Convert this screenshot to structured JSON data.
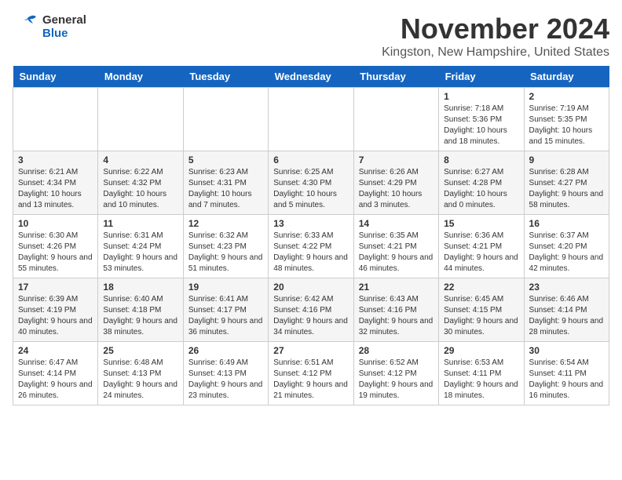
{
  "header": {
    "logo_general": "General",
    "logo_blue": "Blue",
    "month_title": "November 2024",
    "location": "Kingston, New Hampshire, United States"
  },
  "weekdays": [
    "Sunday",
    "Monday",
    "Tuesday",
    "Wednesday",
    "Thursday",
    "Friday",
    "Saturday"
  ],
  "weeks": [
    [
      {
        "day": "",
        "info": ""
      },
      {
        "day": "",
        "info": ""
      },
      {
        "day": "",
        "info": ""
      },
      {
        "day": "",
        "info": ""
      },
      {
        "day": "",
        "info": ""
      },
      {
        "day": "1",
        "info": "Sunrise: 7:18 AM\nSunset: 5:36 PM\nDaylight: 10 hours and 18 minutes."
      },
      {
        "day": "2",
        "info": "Sunrise: 7:19 AM\nSunset: 5:35 PM\nDaylight: 10 hours and 15 minutes."
      }
    ],
    [
      {
        "day": "3",
        "info": "Sunrise: 6:21 AM\nSunset: 4:34 PM\nDaylight: 10 hours and 13 minutes."
      },
      {
        "day": "4",
        "info": "Sunrise: 6:22 AM\nSunset: 4:32 PM\nDaylight: 10 hours and 10 minutes."
      },
      {
        "day": "5",
        "info": "Sunrise: 6:23 AM\nSunset: 4:31 PM\nDaylight: 10 hours and 7 minutes."
      },
      {
        "day": "6",
        "info": "Sunrise: 6:25 AM\nSunset: 4:30 PM\nDaylight: 10 hours and 5 minutes."
      },
      {
        "day": "7",
        "info": "Sunrise: 6:26 AM\nSunset: 4:29 PM\nDaylight: 10 hours and 3 minutes."
      },
      {
        "day": "8",
        "info": "Sunrise: 6:27 AM\nSunset: 4:28 PM\nDaylight: 10 hours and 0 minutes."
      },
      {
        "day": "9",
        "info": "Sunrise: 6:28 AM\nSunset: 4:27 PM\nDaylight: 9 hours and 58 minutes."
      }
    ],
    [
      {
        "day": "10",
        "info": "Sunrise: 6:30 AM\nSunset: 4:26 PM\nDaylight: 9 hours and 55 minutes."
      },
      {
        "day": "11",
        "info": "Sunrise: 6:31 AM\nSunset: 4:24 PM\nDaylight: 9 hours and 53 minutes."
      },
      {
        "day": "12",
        "info": "Sunrise: 6:32 AM\nSunset: 4:23 PM\nDaylight: 9 hours and 51 minutes."
      },
      {
        "day": "13",
        "info": "Sunrise: 6:33 AM\nSunset: 4:22 PM\nDaylight: 9 hours and 48 minutes."
      },
      {
        "day": "14",
        "info": "Sunrise: 6:35 AM\nSunset: 4:21 PM\nDaylight: 9 hours and 46 minutes."
      },
      {
        "day": "15",
        "info": "Sunrise: 6:36 AM\nSunset: 4:21 PM\nDaylight: 9 hours and 44 minutes."
      },
      {
        "day": "16",
        "info": "Sunrise: 6:37 AM\nSunset: 4:20 PM\nDaylight: 9 hours and 42 minutes."
      }
    ],
    [
      {
        "day": "17",
        "info": "Sunrise: 6:39 AM\nSunset: 4:19 PM\nDaylight: 9 hours and 40 minutes."
      },
      {
        "day": "18",
        "info": "Sunrise: 6:40 AM\nSunset: 4:18 PM\nDaylight: 9 hours and 38 minutes."
      },
      {
        "day": "19",
        "info": "Sunrise: 6:41 AM\nSunset: 4:17 PM\nDaylight: 9 hours and 36 minutes."
      },
      {
        "day": "20",
        "info": "Sunrise: 6:42 AM\nSunset: 4:16 PM\nDaylight: 9 hours and 34 minutes."
      },
      {
        "day": "21",
        "info": "Sunrise: 6:43 AM\nSunset: 4:16 PM\nDaylight: 9 hours and 32 minutes."
      },
      {
        "day": "22",
        "info": "Sunrise: 6:45 AM\nSunset: 4:15 PM\nDaylight: 9 hours and 30 minutes."
      },
      {
        "day": "23",
        "info": "Sunrise: 6:46 AM\nSunset: 4:14 PM\nDaylight: 9 hours and 28 minutes."
      }
    ],
    [
      {
        "day": "24",
        "info": "Sunrise: 6:47 AM\nSunset: 4:14 PM\nDaylight: 9 hours and 26 minutes."
      },
      {
        "day": "25",
        "info": "Sunrise: 6:48 AM\nSunset: 4:13 PM\nDaylight: 9 hours and 24 minutes."
      },
      {
        "day": "26",
        "info": "Sunrise: 6:49 AM\nSunset: 4:13 PM\nDaylight: 9 hours and 23 minutes."
      },
      {
        "day": "27",
        "info": "Sunrise: 6:51 AM\nSunset: 4:12 PM\nDaylight: 9 hours and 21 minutes."
      },
      {
        "day": "28",
        "info": "Sunrise: 6:52 AM\nSunset: 4:12 PM\nDaylight: 9 hours and 19 minutes."
      },
      {
        "day": "29",
        "info": "Sunrise: 6:53 AM\nSunset: 4:11 PM\nDaylight: 9 hours and 18 minutes."
      },
      {
        "day": "30",
        "info": "Sunrise: 6:54 AM\nSunset: 4:11 PM\nDaylight: 9 hours and 16 minutes."
      }
    ]
  ]
}
